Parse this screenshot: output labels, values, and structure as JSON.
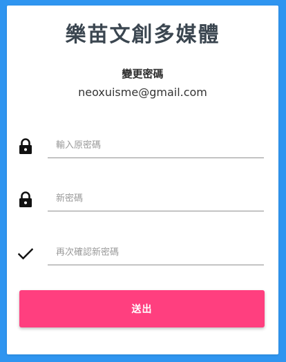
{
  "brand": {
    "title": "樂苗文創多媒體"
  },
  "form": {
    "heading": "變更密碼",
    "email": "neoxuisme@gmail.com",
    "fields": [
      {
        "icon": "lock-icon",
        "placeholder": "輸入原密碼",
        "value": ""
      },
      {
        "icon": "lock-icon",
        "placeholder": "新密碼",
        "value": ""
      },
      {
        "icon": "check-icon",
        "placeholder": "再次確認新密碼",
        "value": ""
      }
    ],
    "submit_label": "送出"
  },
  "colors": {
    "background": "#2f95f0",
    "card": "#ffffff",
    "title_text": "#3b4650",
    "accent_button": "#ff3f7f",
    "underline": "#8f8f8f"
  }
}
